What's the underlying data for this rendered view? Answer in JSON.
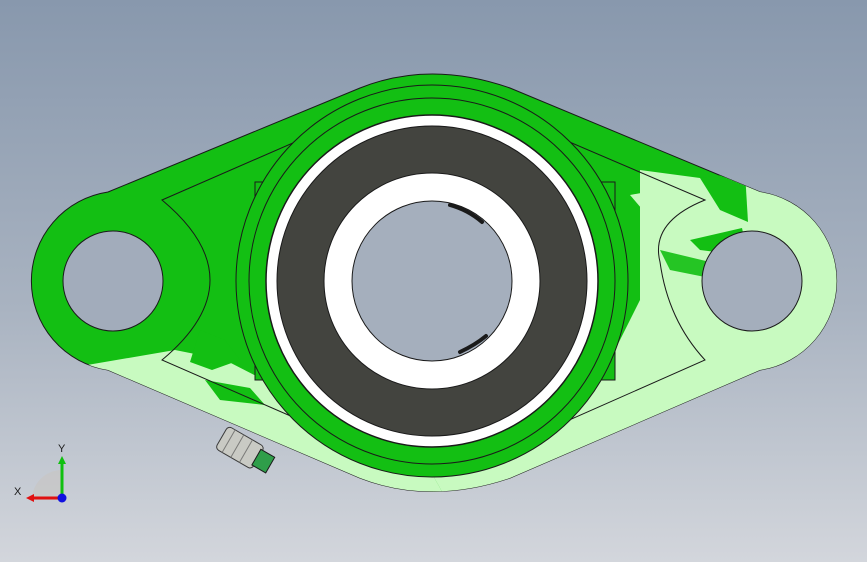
{
  "viewport": {
    "background_top": "#8898ad",
    "background_bottom": "#d3d6dc"
  },
  "model": {
    "housing_color": "#13bf13",
    "housing_light_color": "#c8fac0",
    "insert_color": "#43443f",
    "inner_ring_color": "#ffffff",
    "grease_fitting_color": "#c9cac4"
  },
  "triad": {
    "x_label": "X",
    "y_label": "Y",
    "x_axis_color": "#e01010",
    "y_axis_color": "#10c010",
    "z_axis_color": "#1010e0"
  }
}
